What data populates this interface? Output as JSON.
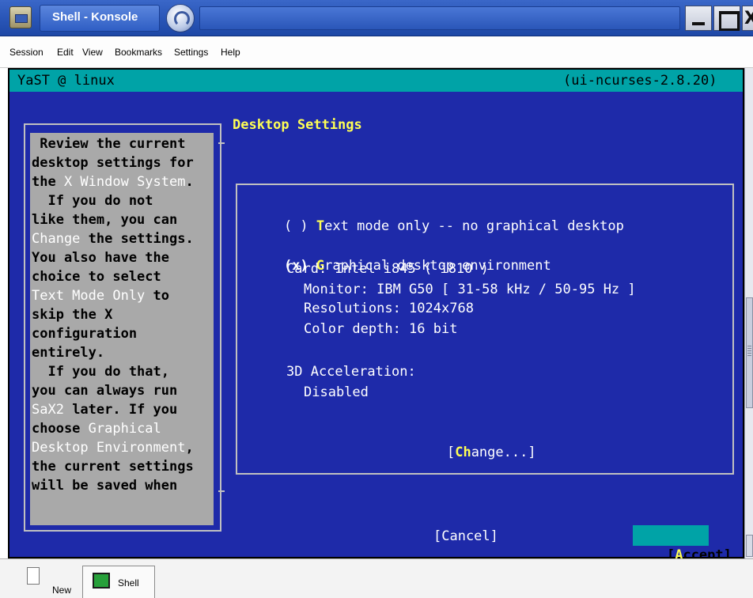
{
  "window": {
    "title": "Shell - Konsole",
    "buttons": [
      "minimize",
      "maximize",
      "close"
    ]
  },
  "menu": [
    "Session",
    "Edit",
    "View",
    "Bookmarks",
    "Settings",
    "Help"
  ],
  "terminal": {
    "header_left": "YaST @ linux",
    "header_right": "(ui-ncurses-2.8.20)",
    "dialog_title": "Desktop Settings",
    "help_lines": [
      [
        {
          "t": " Review the current",
          "hl": false
        }
      ],
      [
        {
          "t": "desktop settings for",
          "hl": false
        }
      ],
      [
        {
          "t": "the ",
          "hl": false
        },
        {
          "t": "X Window System",
          "hl": true
        },
        {
          "t": ".",
          "hl": false
        }
      ],
      [
        {
          "t": "  If you do not",
          "hl": false
        }
      ],
      [
        {
          "t": "like them, you can",
          "hl": false
        }
      ],
      [
        {
          "t": "Change",
          "hl": true
        },
        {
          "t": " the settings.",
          "hl": false
        }
      ],
      [
        {
          "t": "You also have the",
          "hl": false
        }
      ],
      [
        {
          "t": "choice to select",
          "hl": false
        }
      ],
      [
        {
          "t": "Text Mode Only",
          "hl": true
        },
        {
          "t": " to",
          "hl": false
        }
      ],
      [
        {
          "t": "skip the X",
          "hl": false
        }
      ],
      [
        {
          "t": "configuration",
          "hl": false
        }
      ],
      [
        {
          "t": "entirely.",
          "hl": false
        }
      ],
      [
        {
          "t": "  If you do that,",
          "hl": false
        }
      ],
      [
        {
          "t": "you can always run",
          "hl": false
        }
      ],
      [
        {
          "t": "SaX2",
          "hl": true
        },
        {
          "t": " later. If you",
          "hl": false
        }
      ],
      [
        {
          "t": "choose ",
          "hl": false
        },
        {
          "t": "Graphical",
          "hl": true
        }
      ],
      [
        {
          "t": "Desktop Environment",
          "hl": true
        },
        {
          "t": ",",
          "hl": false
        }
      ],
      [
        {
          "t": "the current settings",
          "hl": false
        }
      ],
      [
        {
          "t": "will be saved when",
          "hl": false
        }
      ]
    ],
    "options": {
      "text_mode": {
        "marker": "( )",
        "hotkey": "T",
        "rest": "ext mode only -- no graphical desktop",
        "selected": false
      },
      "graphical": {
        "marker": "(x)",
        "hotkey": "G",
        "rest": "raphical desktop environment",
        "selected": true
      }
    },
    "card": "Card: Intel i845 ( i810 )",
    "monitor": "Monitor: IBM G50 [ 31-58 kHz / 50-95 Hz ]",
    "resolutions": "Resolutions: 1024x768",
    "color_depth": "Color depth: 16 bit",
    "accel_label": "3D Acceleration:",
    "accel_value": "Disabled",
    "change_button": {
      "pre": "[",
      "hotkey": "Ch",
      "post": "ange...]"
    },
    "cancel_button": "[Cancel]",
    "accept_button": {
      "pre": "[",
      "hotkey": "A",
      "post": "ccept]"
    }
  },
  "taskbar": {
    "new_label": "New",
    "shell_label": "Shell"
  },
  "colors": {
    "terminal_bg": "#1e2aa9",
    "header_bg": "#00a3a7",
    "hotkey": "#ffff54",
    "help_bg": "#a9a9a9"
  }
}
